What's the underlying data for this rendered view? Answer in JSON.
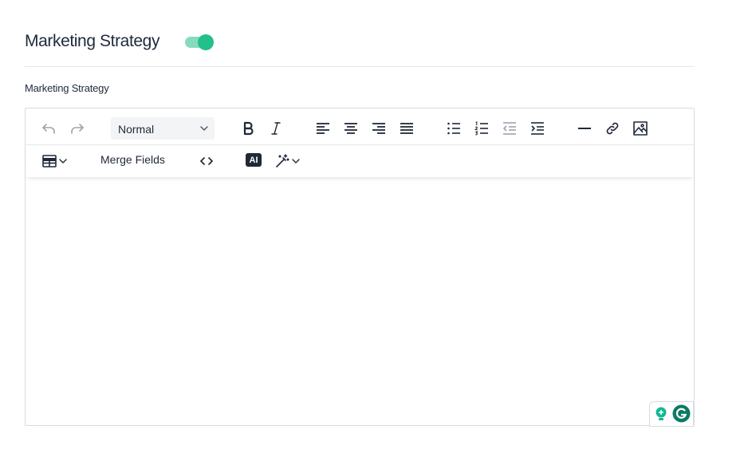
{
  "section": {
    "title": "Marketing Strategy",
    "toggle_on": true,
    "accent_color": "#22c08a"
  },
  "field": {
    "label": "Marketing Strategy"
  },
  "toolbar": {
    "row1": {
      "undo_icon": "undo-icon",
      "redo_icon": "redo-icon",
      "style_select": {
        "value": "Normal"
      },
      "bold_icon": "bold-icon",
      "italic_icon": "italic-icon",
      "align_icons": [
        "align-left-icon",
        "align-center-icon",
        "align-right-icon",
        "align-justify-icon"
      ],
      "list_icons": [
        "bullet-list-icon",
        "numbered-list-icon",
        "outdent-icon",
        "indent-icon"
      ],
      "insert_icons": [
        "horizontal-rule-icon",
        "link-icon",
        "image-icon"
      ]
    },
    "row2": {
      "table_icon": "table-icon",
      "merge_fields_label": "Merge Fields",
      "code_icon": "code-icon",
      "ai_badge_label": "AI",
      "magic_wand_icon": "magic-wand-icon"
    }
  },
  "editor": {
    "content": ""
  },
  "grammarly": {
    "icons": [
      "lightbulb-icon",
      "grammarly-icon"
    ]
  }
}
